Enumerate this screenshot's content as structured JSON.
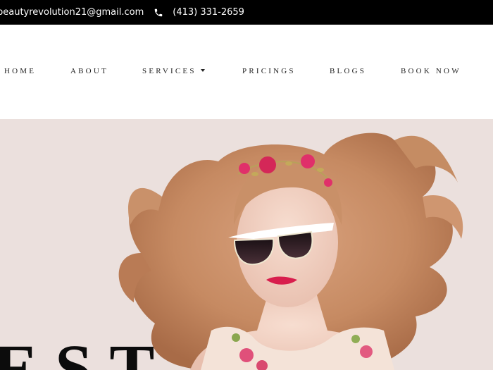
{
  "topbar": {
    "email": "beautyrevolution21@gmail.com",
    "phone": "(413) 331-2659",
    "phone_icon": "phone-icon"
  },
  "nav": {
    "items": [
      {
        "label": "HOME"
      },
      {
        "label": "ABOUT"
      },
      {
        "label": "SERVICES",
        "has_dropdown": true
      },
      {
        "label": "PRICINGS"
      },
      {
        "label": "BLOGS"
      },
      {
        "label": "BOOK NOW"
      }
    ]
  },
  "hero": {
    "partial_text": "EST",
    "background_color": "#ebe0dd"
  }
}
